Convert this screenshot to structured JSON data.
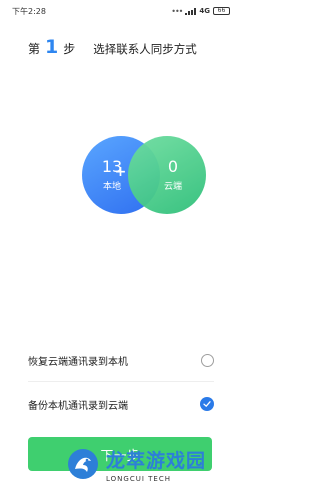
{
  "status_bar": {
    "time": "下午2:28",
    "network": "4G",
    "battery": "66"
  },
  "step": {
    "prefix": "第",
    "number": "1",
    "suffix": "步",
    "title": "选择联系人同步方式"
  },
  "venn": {
    "local": {
      "count": "13",
      "label": "本地"
    },
    "cloud": {
      "count": "0",
      "label": "云端"
    }
  },
  "options": [
    {
      "label": "恢复云端通讯录到本机",
      "selected": false
    },
    {
      "label": "备份本机通讯录到云端",
      "selected": true
    }
  ],
  "next_button": {
    "label": "下一步"
  },
  "watermark": {
    "title": "龙萃游戏园",
    "subtitle": "LONGCUI TECH"
  },
  "colors": {
    "accent_blue": "#2e86f0",
    "button_green": "#3fcf6f",
    "check_blue": "#2a7ae8"
  }
}
